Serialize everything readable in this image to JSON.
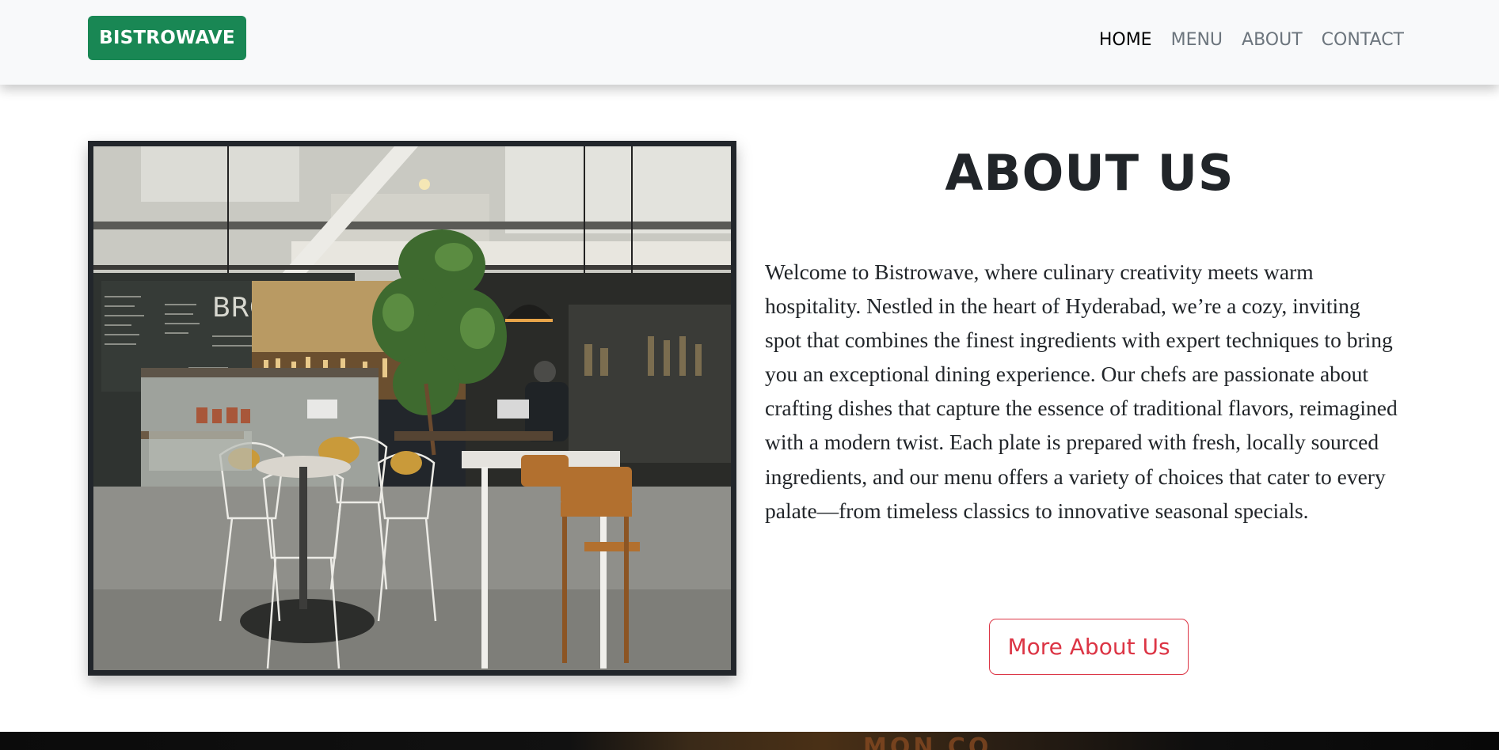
{
  "navbar": {
    "brand": "BISTROWAVE",
    "links": [
      {
        "label": "HOME",
        "active": true
      },
      {
        "label": "MENU",
        "active": false
      },
      {
        "label": "ABOUT",
        "active": false
      },
      {
        "label": "CONTACT",
        "active": false
      }
    ]
  },
  "about": {
    "title": "ABOUT US",
    "text": "Welcome to Bistrowave, where culinary creativity meets warm hospitality. Nestled in the heart of Hyderabad, we’re a cozy, inviting spot that combines the finest ingredients with expert techniques to bring you an exceptional dining experience. Our chefs are passionate about crafting dishes that capture the essence of traditional flavors, reimagined with a modern twist. Each plate is prepared with fresh, locally sourced ingredients, and our menu offers a variety of choices that cater to every palate—from timeless classics to innovative seasonal specials.",
    "button_label": "More About Us",
    "photo_board_text": "BROEI"
  },
  "next_section": {
    "visible_sign_text": "MON CO"
  },
  "colors": {
    "brand_green": "#198754",
    "button_red": "#dc3545",
    "navbar_bg": "#f8f9fa",
    "text_dark": "#212529"
  }
}
